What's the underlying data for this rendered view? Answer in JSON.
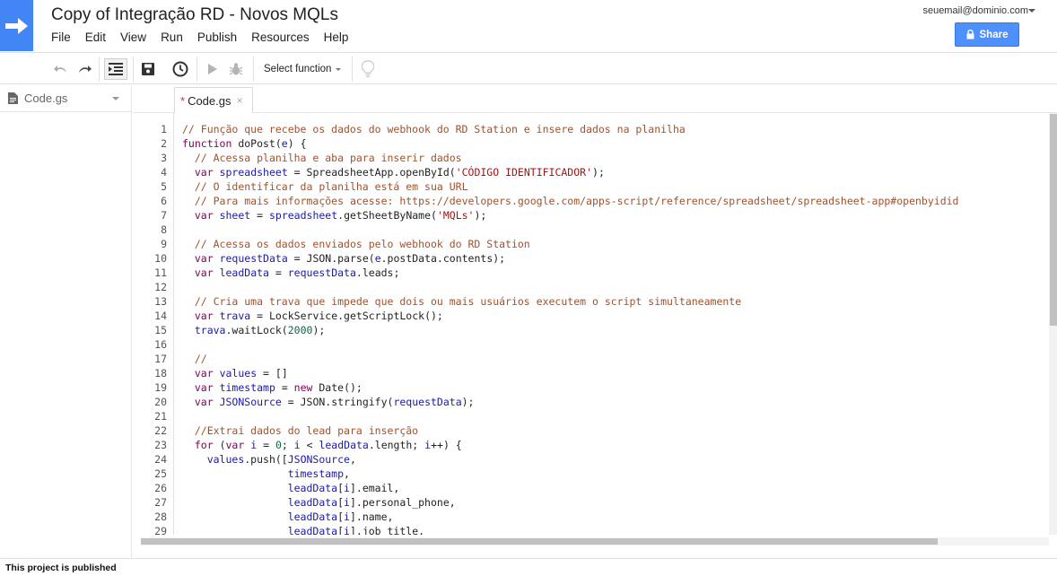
{
  "app": {
    "title": "Copy of Integração RD - Novos MQLs",
    "account_email": "seuemail@dominio.com",
    "share_label": "Share"
  },
  "menu": [
    "File",
    "Edit",
    "View",
    "Run",
    "Publish",
    "Resources",
    "Help"
  ],
  "toolbar": {
    "select_function_label": "Select function"
  },
  "files": {
    "current": "Code.gs"
  },
  "tab": {
    "label": "Code.gs",
    "unsaved_marker": "*",
    "close_glyph": "×"
  },
  "code": {
    "lines": [
      "// Função que recebe os dados do webhook do RD Station e insere dados na planilha",
      "function doPost(e) {",
      "  // Acessa planilha e aba para inserir dados",
      "  var spreadsheet = SpreadsheetApp.openById('CÓDIGO IDENTIFICADOR');",
      "  // O identificar da planilha está em sua URL",
      "  // Para mais informações acesse: https://developers.google.com/apps-script/reference/spreadsheet/spreadsheet-app#openbyidid",
      "  var sheet = spreadsheet.getSheetByName('MQLs');",
      "",
      "  // Acessa os dados enviados pelo webhook do RD Station",
      "  var requestData = JSON.parse(e.postData.contents);",
      "  var leadData = requestData.leads;",
      "",
      "  // Cria uma trava que impede que dois ou mais usuários executem o script simultaneamente",
      "  var trava = LockService.getScriptLock();",
      "  trava.waitLock(2000);",
      "",
      "  //",
      "  var values = []",
      "  var timestamp = new Date();",
      "  var JSONSource = JSON.stringify(requestData);",
      "",
      "  //Extrai dados do lead para inserção",
      "  for (var i = 0; i < leadData.length; i++) {",
      "    values.push([JSONSource,",
      "                 timestamp,",
      "                 leadData[i].email,",
      "                 leadData[i].personal_phone,",
      "                 leadData[i].name,",
      "                 leadData[i].job_title,"
    ]
  },
  "status": {
    "text": "This project is published"
  },
  "colors": {
    "accent": "#4285f4",
    "share_button": "#4d90fe",
    "comment": "#a0522d",
    "keyword": "#7f0055",
    "variable": "#1a1aa6",
    "string": "#a31515",
    "number": "#116644"
  }
}
